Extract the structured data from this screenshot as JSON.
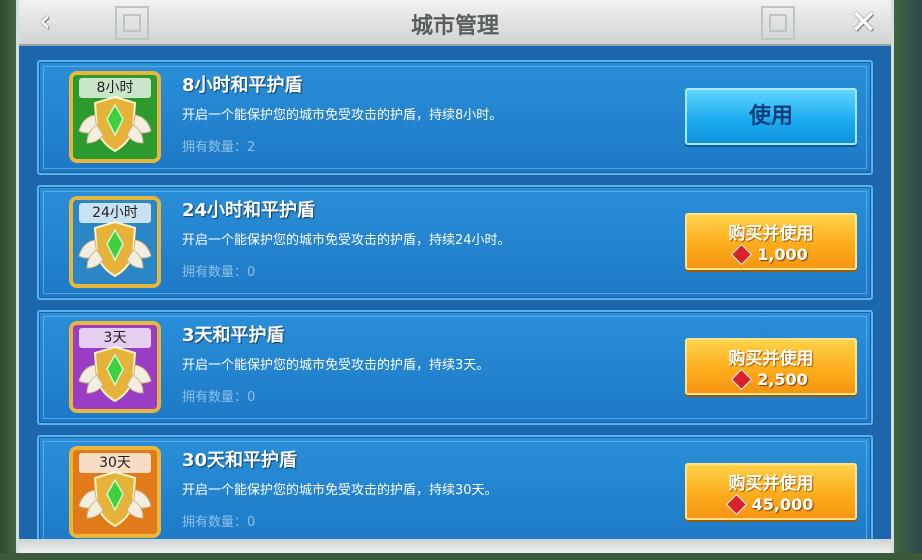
{
  "header": {
    "title": "城市管理",
    "back_icon": "‹",
    "close_icon": "✕"
  },
  "items": [
    {
      "badge": "8小时",
      "name": "8小时和平护盾",
      "desc": "开启一个能保护您的城市免受攻击的护盾，持续8小时。",
      "owned": "拥有数量：2",
      "button_type": "use",
      "button_label": "使用",
      "price": "",
      "icon_color": "#2c9a2c"
    },
    {
      "badge": "24小时",
      "name": "24小时和平护盾",
      "desc": "开启一个能保护您的城市免受攻击的护盾，持续24小时。",
      "owned": "拥有数量：0",
      "button_type": "buy",
      "button_label": "购买并使用",
      "price": "1,000",
      "icon_color": "#2a86c4"
    },
    {
      "badge": "3天",
      "name": "3天和平护盾",
      "desc": "开启一个能保护您的城市免受攻击的护盾，持续3天。",
      "owned": "拥有数量：0",
      "button_type": "buy",
      "button_label": "购买并使用",
      "price": "2,500",
      "icon_color": "#9a3cc4"
    },
    {
      "badge": "30天",
      "name": "30天和平护盾",
      "desc": "开启一个能保护您的城市免受攻击的护盾，持续30天。",
      "owned": "拥有数量：0",
      "button_type": "buy",
      "button_label": "购买并使用",
      "price": "45,000",
      "icon_color": "#e27a1a"
    }
  ]
}
